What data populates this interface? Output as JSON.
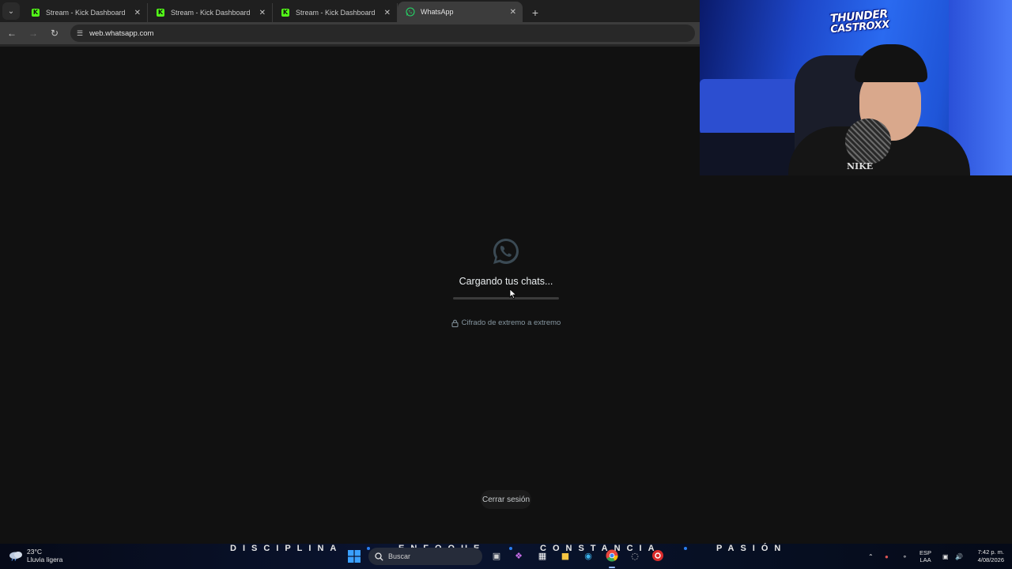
{
  "browser": {
    "tabs": [
      {
        "title": "Stream - Kick Dashboard",
        "favicon": "kick-logo",
        "active": false
      },
      {
        "title": "Stream - Kick Dashboard",
        "favicon": "kick-logo",
        "active": false
      },
      {
        "title": "Stream - Kick Dashboard",
        "favicon": "kick-logo",
        "active": false
      },
      {
        "title": "WhatsApp",
        "favicon": "whatsapp-logo",
        "active": true
      }
    ],
    "url": "web.whatsapp.com"
  },
  "whatsapp": {
    "loading_text": "Cargando tus chats...",
    "progress": 0.0,
    "encryption_text": "Cifrado de extremo a extremo",
    "logout_label": "Cerrar sesión"
  },
  "webcam": {
    "logo_line1": "THUNDER",
    "logo_line2": "CASTROXX",
    "shirt_text": "NIKE"
  },
  "taskbar": {
    "weather_temp": "23°C",
    "weather_desc": "Lluvia ligera",
    "motto": [
      "DISCIPLINA",
      "ENFOQUE",
      "CONSTANCIA",
      "PASIÓN"
    ],
    "search_placeholder": "Buscar",
    "lang_line1": "ESP",
    "lang_line2": "LAA",
    "time": "7:42 p. m.",
    "date": "4/08/2026"
  },
  "colors": {
    "background": "#111111",
    "kick_green": "#53fc18",
    "whatsapp_icon": "#3b4a54",
    "taskbar_accent": "#2a7ef0"
  }
}
